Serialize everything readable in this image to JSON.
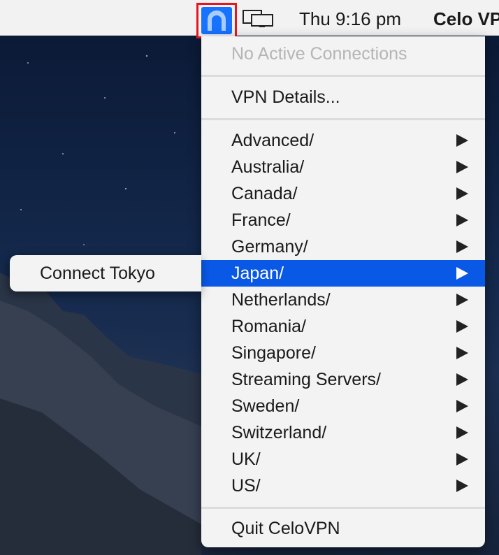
{
  "menubar": {
    "clock": "Thu 9:16 pm",
    "app_name": "Celo VPN",
    "vpn_icon": "vpn-arch-icon",
    "displays_icon": "displays-icon"
  },
  "vpn_menu": {
    "status": "No Active Connections",
    "details": "VPN Details...",
    "locations": [
      {
        "label": "Advanced/"
      },
      {
        "label": "Australia/"
      },
      {
        "label": "Canada/"
      },
      {
        "label": "France/"
      },
      {
        "label": "Germany/"
      },
      {
        "label": "Japan/",
        "selected": true
      },
      {
        "label": "Netherlands/"
      },
      {
        "label": "Romania/"
      },
      {
        "label": "Singapore/"
      },
      {
        "label": "Streaming Servers/"
      },
      {
        "label": "Sweden/"
      },
      {
        "label": "Switzerland/"
      },
      {
        "label": "UK/"
      },
      {
        "label": "US/"
      }
    ],
    "quit": "Quit CeloVPN"
  },
  "submenu": {
    "item": "Connect Tokyo"
  },
  "colors": {
    "highlight": "#0a58e6",
    "status_icon_bg": "#1672ff",
    "outline_red": "#e8161c"
  }
}
